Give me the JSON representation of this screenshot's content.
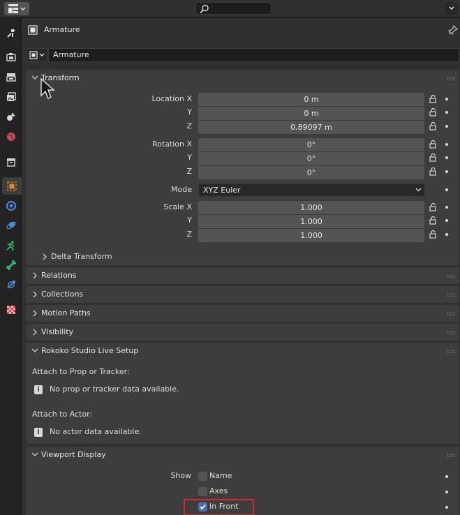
{
  "topbar": {
    "editor_icon": "properties-editor-icon",
    "search_icon": "search-icon",
    "search_placeholder": ""
  },
  "tabs": [
    {
      "name": "tool-tab",
      "icon": "wrench-screwdriver-icon"
    },
    {
      "name": "render-tab",
      "icon": "camera-back-icon"
    },
    {
      "name": "output-tab",
      "icon": "printer-icon"
    },
    {
      "name": "view-layer-tab",
      "icon": "images-icon"
    },
    {
      "name": "scene-tab",
      "icon": "cone-sphere-icon"
    },
    {
      "name": "world-tab",
      "icon": "globe-icon"
    },
    {
      "name": "collection-tab",
      "icon": "box-icon"
    },
    {
      "name": "object-tab",
      "icon": "object-square-icon",
      "active": true
    },
    {
      "name": "modifiers-tab",
      "icon": "blue-circle-icon"
    },
    {
      "name": "physics-tab",
      "icon": "orbit-icon"
    },
    {
      "name": "constraints-tab",
      "icon": "running-figure-icon"
    },
    {
      "name": "data-tab",
      "icon": "bone-icon"
    },
    {
      "name": "bone-constraints-tab",
      "icon": "satellite-icon"
    },
    {
      "name": "texture-tab",
      "icon": "checker-icon"
    }
  ],
  "header": {
    "title": "Armature",
    "name_value": "Armature"
  },
  "transform": {
    "title": "Transform",
    "location": {
      "label_x": "Location X",
      "label_y": "Y",
      "label_z": "Z",
      "x": "0 m",
      "y": "0 m",
      "z": "0.89097 m"
    },
    "rotation": {
      "label_x": "Rotation X",
      "label_y": "Y",
      "label_z": "Z",
      "x": "0°",
      "y": "0°",
      "z": "0°"
    },
    "mode": {
      "label": "Mode",
      "value": "XYZ Euler"
    },
    "scale": {
      "label_x": "Scale X",
      "label_y": "Y",
      "label_z": "Z",
      "x": "1.000",
      "y": "1.000",
      "z": "1.000"
    },
    "delta": "Delta Transform"
  },
  "panels": {
    "relations": "Relations",
    "collections": "Collections",
    "motion_paths": "Motion Paths",
    "visibility": "Visibility"
  },
  "rokoko": {
    "title": "Rokoko Studio Live Setup",
    "prop_label": "Attach to Prop or Tracker:",
    "prop_info": "No prop or tracker data available.",
    "actor_label": "Attach to Actor:",
    "actor_info": "No actor data available.",
    "info_glyph": "i"
  },
  "viewport_display": {
    "title": "Viewport Display",
    "show_label": "Show",
    "name_label": "Name",
    "axes_label": "Axes",
    "in_front_label": "In Front",
    "name_checked": false,
    "axes_checked": false,
    "in_front_checked": true
  },
  "colors": {
    "accent": "#4772b3",
    "highlight": "#d8262b",
    "panel": "#3d3d3d",
    "background": "#303030"
  }
}
